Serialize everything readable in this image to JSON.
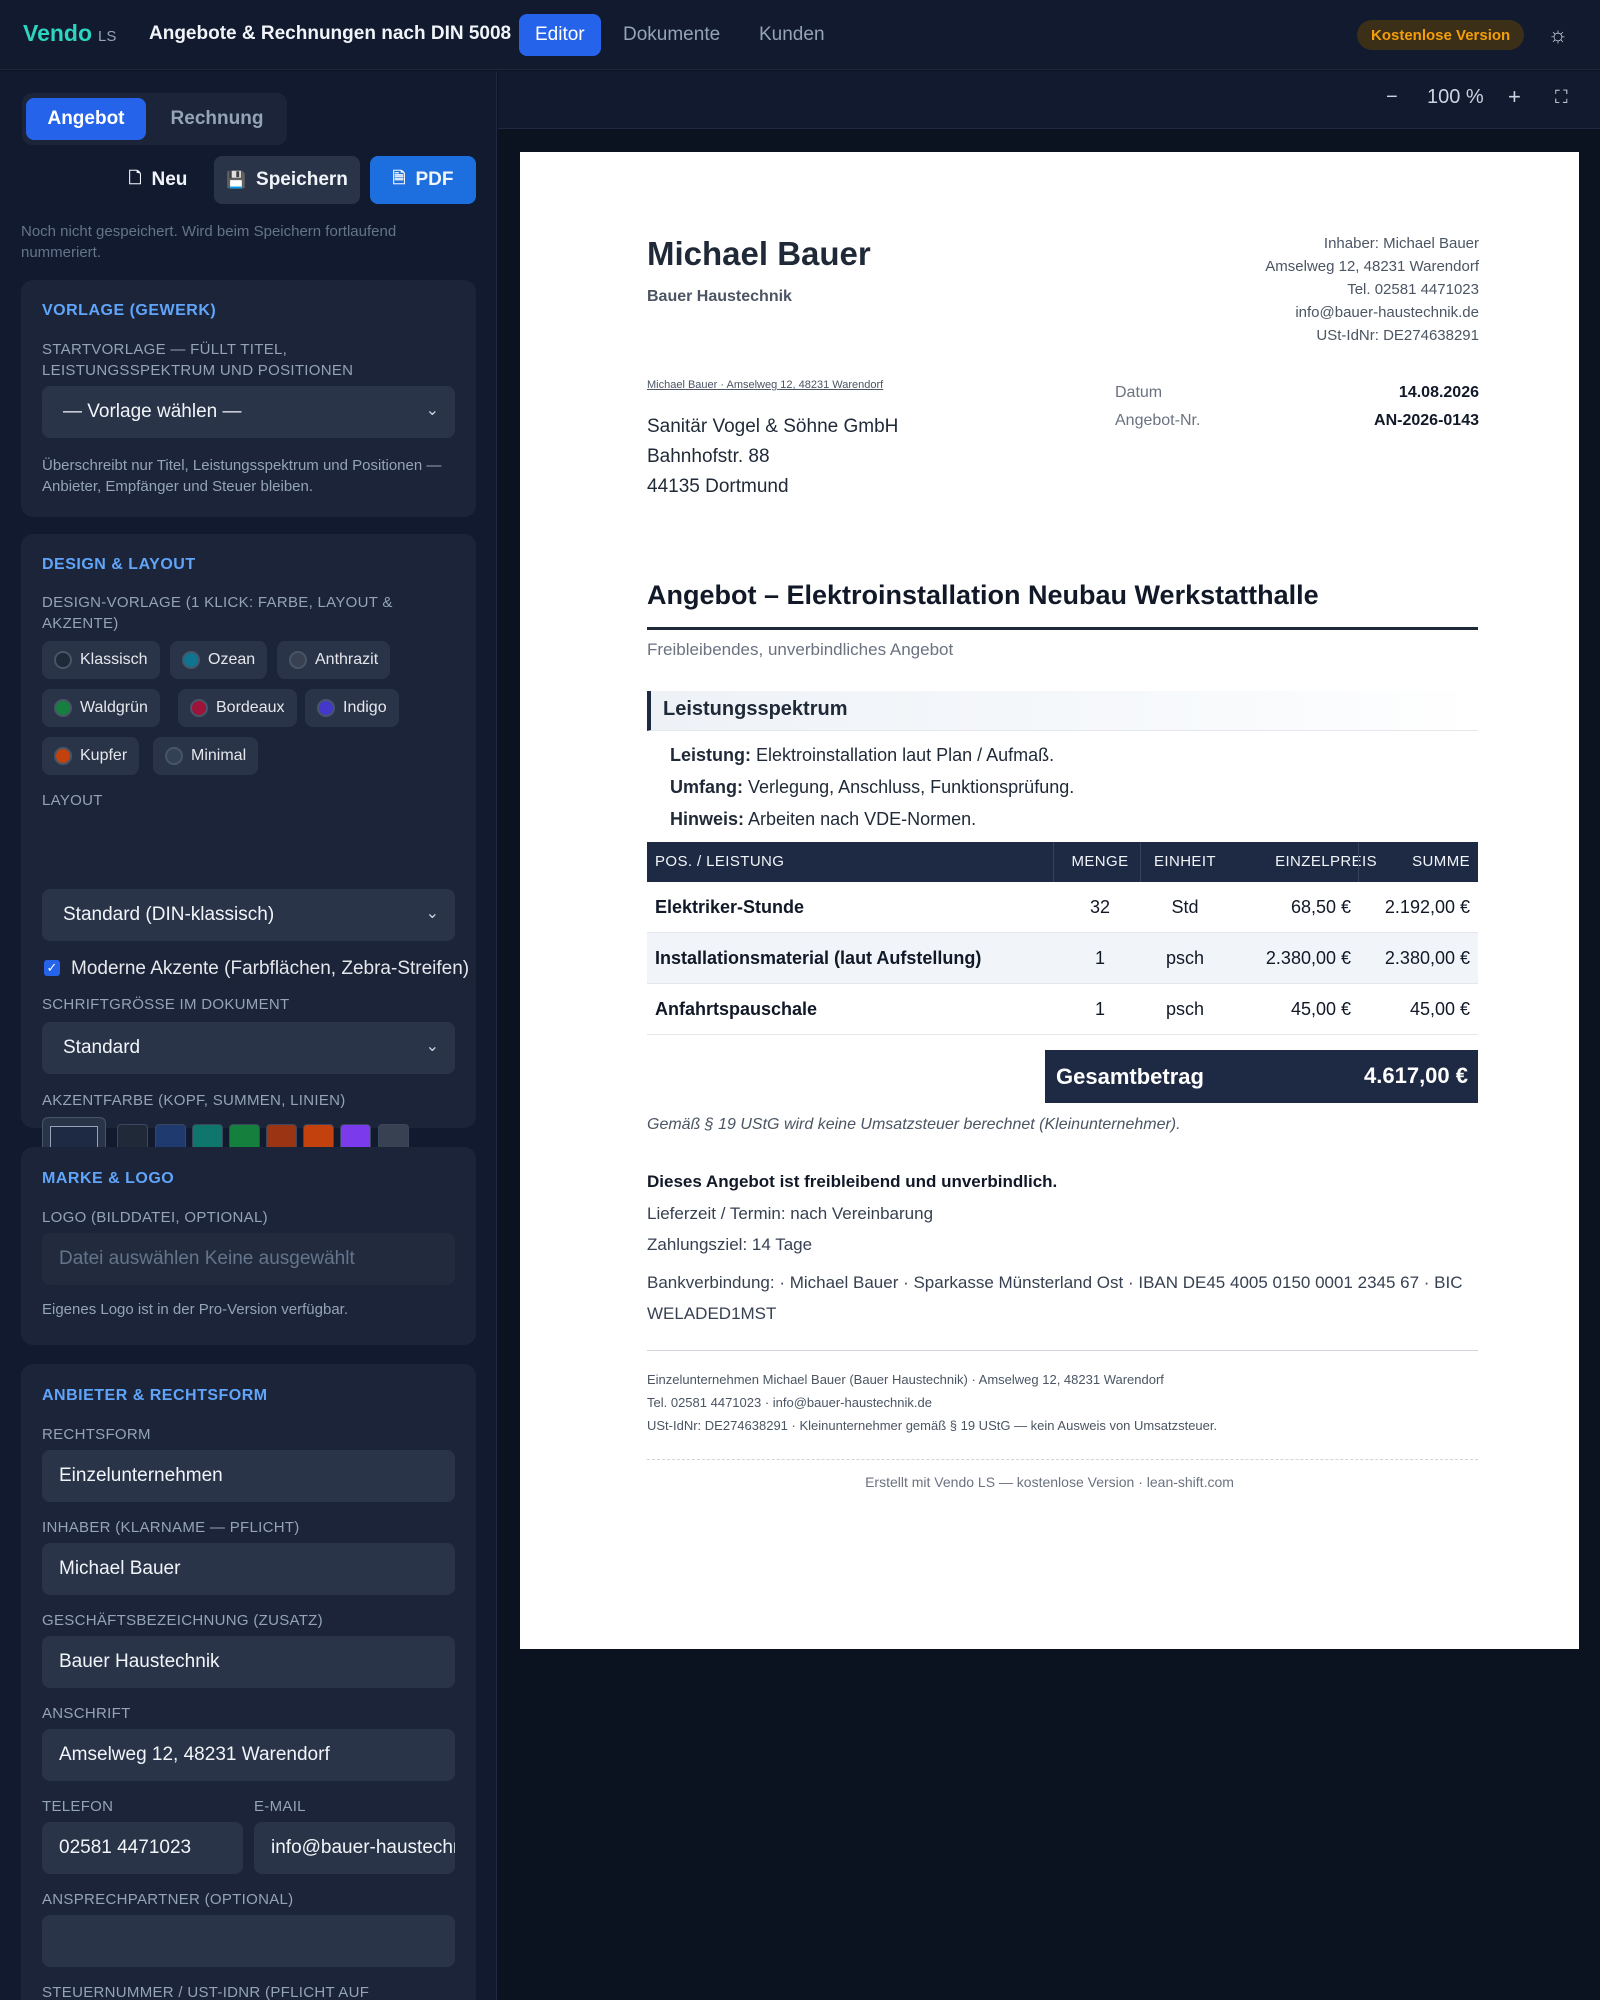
{
  "topbar": {
    "brand": "Vendo",
    "brand_suffix": "LS",
    "title": "Angebote & Rechnungen nach DIN 5008",
    "nav": [
      "Editor",
      "Dokumente",
      "Kunden"
    ],
    "badge": "Kostenlose Version",
    "theme_icon": "sun-icon"
  },
  "sidebar": {
    "doc_types": [
      "Angebot",
      "Rechnung"
    ],
    "actions": {
      "new": "Neu",
      "save": "Speichern",
      "pdf": "PDF"
    },
    "save_hint": "Noch nicht gespeichert. Wird beim Speichern fortlaufend nummeriert.",
    "vorlage": {
      "title": "VORLAGE (GEWERK)",
      "label": "STARTVORLAGE — FÜLLT TITEL, LEISTUNGSSPEKTRUM UND POSITIONEN",
      "select": "— Vorlage wählen —",
      "note": "Überschreibt nur Titel, Leistungsspektrum und Positionen — Anbieter, Empfänger und Steuer bleiben."
    },
    "design": {
      "title": "DESIGN & LAYOUT",
      "preset_label": "DESIGN-VORLAGE (1 KLICK: FARBE, LAYOUT & AKZENTE)",
      "presets": [
        {
          "name": "Klassisch",
          "color": "#1f2937"
        },
        {
          "name": "Ozean",
          "color": "#0e7490"
        },
        {
          "name": "Anthrazit",
          "color": "#374151"
        },
        {
          "name": "Waldgrün",
          "color": "#15803d"
        },
        {
          "name": "Bordeaux",
          "color": "#9f1239"
        },
        {
          "name": "Indigo",
          "color": "#4338ca"
        },
        {
          "name": "Kupfer",
          "color": "#c2410c"
        },
        {
          "name": "Minimal",
          "color": "#334155"
        }
      ],
      "layout_label": "LAYOUT",
      "layout_value": "Standard (DIN-klassisch)",
      "accents_label": "Moderne Akzente (Farbflächen, Zebra-Streifen)",
      "accents_checked": true,
      "font_label": "SCHRIFTGRÖSSE IM DOKUMENT",
      "font_value": "Standard",
      "accent_label": "AKZENTFARBE (KOPF, SUMMEN, LINIEN)",
      "accent_current": "#1e2a44",
      "accent_colors": [
        "#1f2937",
        "#1e3a6e",
        "#0f766e",
        "#15803d",
        "#9a3412",
        "#c2410c",
        "#7c3aed",
        "#374151"
      ]
    },
    "brand_logo": {
      "title": "MARKE & LOGO",
      "label": "LOGO (BILDDATEI, OPTIONAL)",
      "file_text": "Datei auswählen  Keine ausgewählt",
      "note": "Eigenes Logo ist in der Pro-Version verfügbar."
    },
    "provider": {
      "title": "ANBIETER & RECHTSFORM",
      "rechtsform_label": "RECHTSFORM",
      "rechtsform": "Einzelunternehmen",
      "inhaber_label": "INHABER (KLARNAME — PFLICHT)",
      "inhaber": "Michael Bauer",
      "geschaeft_label": "GESCHÄFTSBEZEICHNUNG (ZUSATZ)",
      "geschaeft": "Bauer Haustechnik",
      "anschrift_label": "ANSCHRIFT",
      "anschrift": "Amselweg 12, 48231 Warendorf",
      "telefon_label": "TELEFON",
      "telefon": "02581 4471023",
      "email_label": "E-MAIL",
      "email": "info@bauer-haustechnik.de",
      "ansprech_label": "ANSPRECHPARTNER (OPTIONAL)",
      "ansprech": "",
      "steuer_label": "STEUERNUMMER / UST-IDNR (PFLICHT AUF"
    }
  },
  "preview": {
    "zoom": "100 %",
    "zoom_out": "−",
    "zoom_in": "+",
    "fullscreen_icon": "fullscreen-icon"
  },
  "document": {
    "name": "Michael Bauer",
    "company": "Bauer Haustechnik",
    "sender_lines": [
      "Inhaber: Michael Bauer",
      "Amselweg 12, 48231 Warendorf",
      "Tel. 02581 4471023",
      "info@bauer-haustechnik.de",
      "USt-IdNr: DE274638291"
    ],
    "return_line": "Michael Bauer · Amselweg 12, 48231 Warendorf",
    "recipient": [
      "Sanitär Vogel & Söhne GmbH",
      "Bahnhofstr. 88",
      "44135 Dortmund"
    ],
    "meta": [
      {
        "label": "Datum",
        "value": "14.08.2026"
      },
      {
        "label": "Angebot-Nr.",
        "value": "AN-2026-0143"
      }
    ],
    "title": "Angebot – Elektroinstallation Neubau Werkstatthalle",
    "subtitle": "Freibleibendes, unverbindliches Angebot",
    "scope_title": "Leistungsspektrum",
    "scope": [
      {
        "key": "Leistung:",
        "text": "Elektroinstallation laut Plan / Aufmaß."
      },
      {
        "key": "Umfang:",
        "text": "Verlegung, Anschluss, Funktionsprüfung."
      },
      {
        "key": "Hinweis:",
        "text": "Arbeiten nach VDE-Normen."
      }
    ],
    "columns": [
      "POS. / LEISTUNG",
      "MENGE",
      "EINHEIT",
      "EINZELPREIS",
      "SUMME"
    ],
    "rows": [
      {
        "desc": "Elektriker-Stunde",
        "qty": "32",
        "unit": "Std",
        "price": "68,50 €",
        "sum": "2.192,00 €"
      },
      {
        "desc": "Installationsmaterial (laut Aufstellung)",
        "qty": "1",
        "unit": "psch",
        "price": "2.380,00 €",
        "sum": "2.380,00 €"
      },
      {
        "desc": "Anfahrtspauschale",
        "qty": "1",
        "unit": "psch",
        "price": "45,00 €",
        "sum": "45,00 €"
      }
    ],
    "total_label": "Gesamtbetrag",
    "total_value": "4.617,00 €",
    "tax_note": "Gemäß § 19 UStG wird keine Umsatzsteuer berechnet (Kleinunternehmer).",
    "terms_bold": "Dieses Angebot ist freibleibend und unverbindlich.",
    "terms": [
      "Lieferzeit / Termin: nach Vereinbarung",
      "Zahlungsziel: 14 Tage"
    ],
    "bank": "Bankverbindung: · Michael Bauer · Sparkasse Münsterland Ost · IBAN DE45 4005 0150 0001 2345 67 · BIC WELADED1MST",
    "footer": [
      "Einzelunternehmen Michael Bauer (Bauer Haustechnik) · Amselweg 12, 48231 Warendorf",
      "Tel. 02581 4471023 · info@bauer-haustechnik.de",
      "USt-IdNr: DE274638291 · Kleinunternehmer gemäß § 19 UStG — kein Ausweis von Umsatzsteuer."
    ],
    "credit": "Erstellt mit Vendo LS — kostenlose Version · lean-shift.com"
  }
}
